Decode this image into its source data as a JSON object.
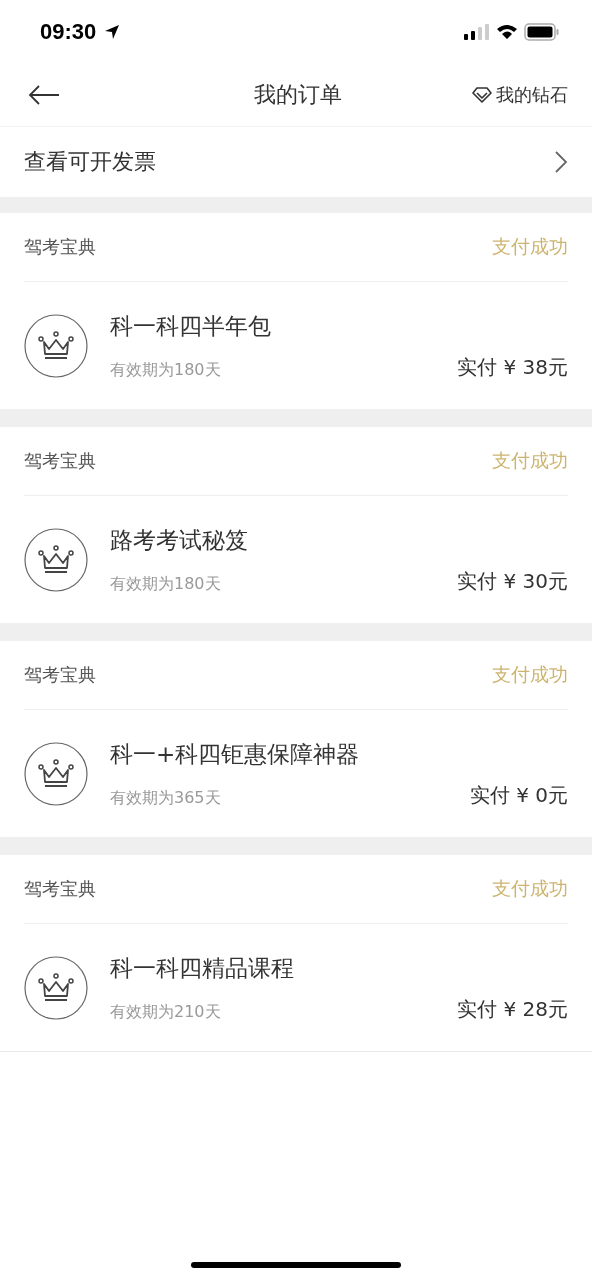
{
  "status_bar": {
    "time": "09:30"
  },
  "nav": {
    "title": "我的订单",
    "action": "我的钻石"
  },
  "invoice_row": {
    "label": "查看可开发票"
  },
  "orders": [
    {
      "shop": "驾考宝典",
      "status": "支付成功",
      "product": "科一科四半年包",
      "validity": "有效期为180天",
      "paid": "实付 ¥ 38元"
    },
    {
      "shop": "驾考宝典",
      "status": "支付成功",
      "product": "路考考试秘笈",
      "validity": "有效期为180天",
      "paid": "实付 ¥ 30元"
    },
    {
      "shop": "驾考宝典",
      "status": "支付成功",
      "product": "科一+科四钜惠保障神器",
      "validity": "有效期为365天",
      "paid": "实付 ¥ 0元"
    },
    {
      "shop": "驾考宝典",
      "status": "支付成功",
      "product": "科一科四精品课程",
      "validity": "有效期为210天",
      "paid": "实付 ¥ 28元"
    }
  ]
}
